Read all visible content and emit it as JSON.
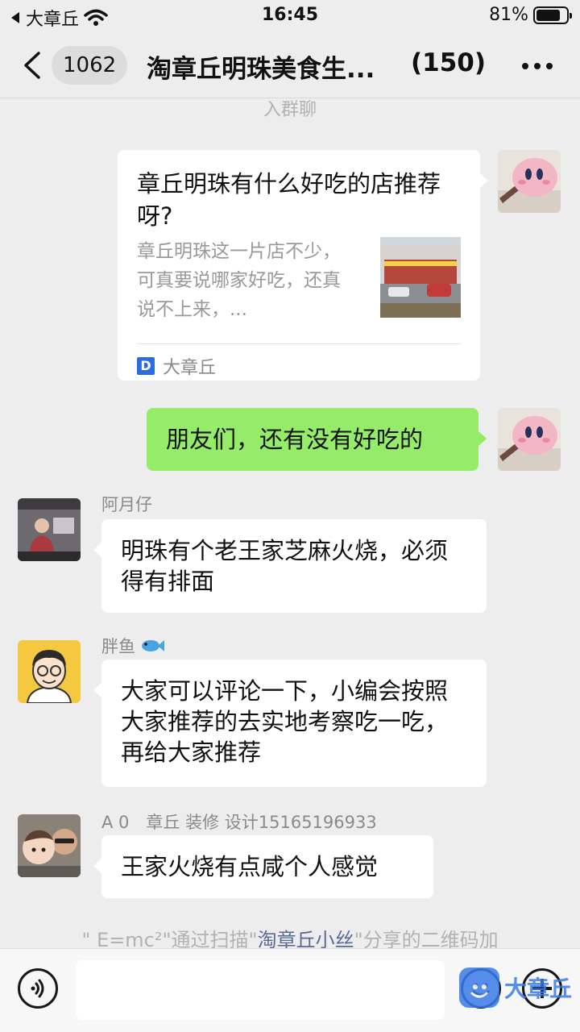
{
  "status_bar": {
    "carrier": "大章丘",
    "time": "16:45",
    "battery": "81%",
    "battery_level": 0.81
  },
  "nav": {
    "back_count": "1062",
    "title": "淘章丘明珠美食生...",
    "member_count": "(150)"
  },
  "system_top": "入群聊",
  "messages": {
    "card": {
      "title": "章丘明珠有什么好吃的店推荐呀?",
      "description": "章丘明珠这一片店不少，可真要说哪家好吃，还真说不上来，...",
      "source": "大章丘"
    },
    "self_text": "朋友们，还有没有好吃的",
    "msg1": {
      "sender": "阿月仔",
      "text": "明珠有个老王家芝麻火烧，必须得有排面"
    },
    "msg2": {
      "sender": "胖鱼",
      "text": "大家可以评论一下，小编会按照大家推荐的去实地考察吃一吃，再给大家推荐"
    },
    "msg3": {
      "sender": "A 0　章丘 装修 设计15165196933",
      "text": "王家火烧有点咸个人感觉"
    }
  },
  "system_bottom": {
    "part1": "\" E=mc²\"通过扫描\"",
    "link": "淘章丘小丝",
    "part2": "\"分享的二维码加"
  },
  "watermark": "大章丘"
}
